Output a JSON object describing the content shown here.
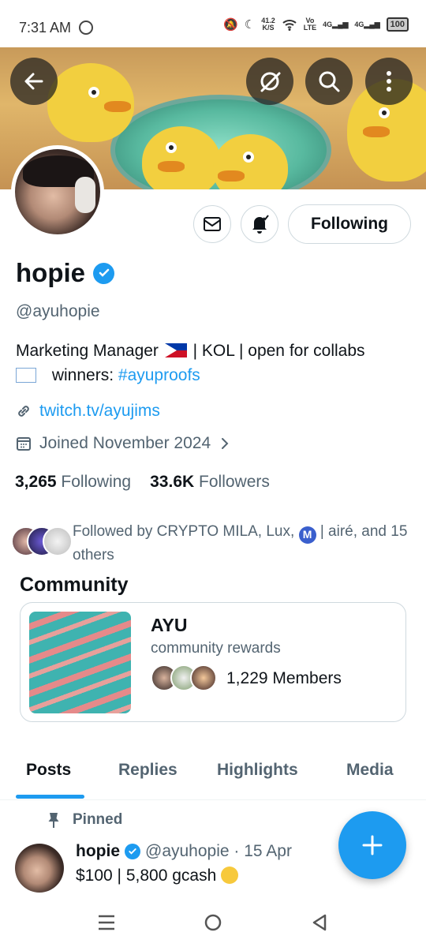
{
  "status": {
    "time": "7:31 AM",
    "speed_value": "41.2",
    "speed_unit": "K/S",
    "vo_label": "Vo",
    "lte_label": "LTE",
    "net1": "4G",
    "net2": "4G",
    "battery": "100"
  },
  "profile": {
    "name": "hopie",
    "handle": "@ayuhopie",
    "bio_part1": "Marketing Manager",
    "bio_part2": "| KOL | open for collabs",
    "bio_part3": "winners:",
    "bio_hashtag": "#ayuproofs",
    "link": "twitch.tv/ayujims",
    "joined": "Joined November 2024",
    "following_count": "3,265",
    "following_label": "Following",
    "followers_count": "33.6K",
    "followers_label": "Followers",
    "followed_by_1": "Followed by CRYPTO MILA, Lux,",
    "followed_by_badge": "M",
    "followed_by_2": "| airé, and 15 others"
  },
  "actions": {
    "following_button": "Following"
  },
  "community": {
    "title": "Community",
    "name": "AYU",
    "subtitle": "community rewards",
    "members": "1,229 Members"
  },
  "tabs": [
    "Posts",
    "Replies",
    "Highlights",
    "Media"
  ],
  "post": {
    "pinned_label": "Pinned",
    "name": "hopie",
    "meta": "@ayuhopie · 15 Apr",
    "text": "$100 | 5,800 gcash"
  },
  "colors": {
    "accent": "#1d9bf0",
    "text": "#0f1419",
    "muted": "#536471"
  }
}
